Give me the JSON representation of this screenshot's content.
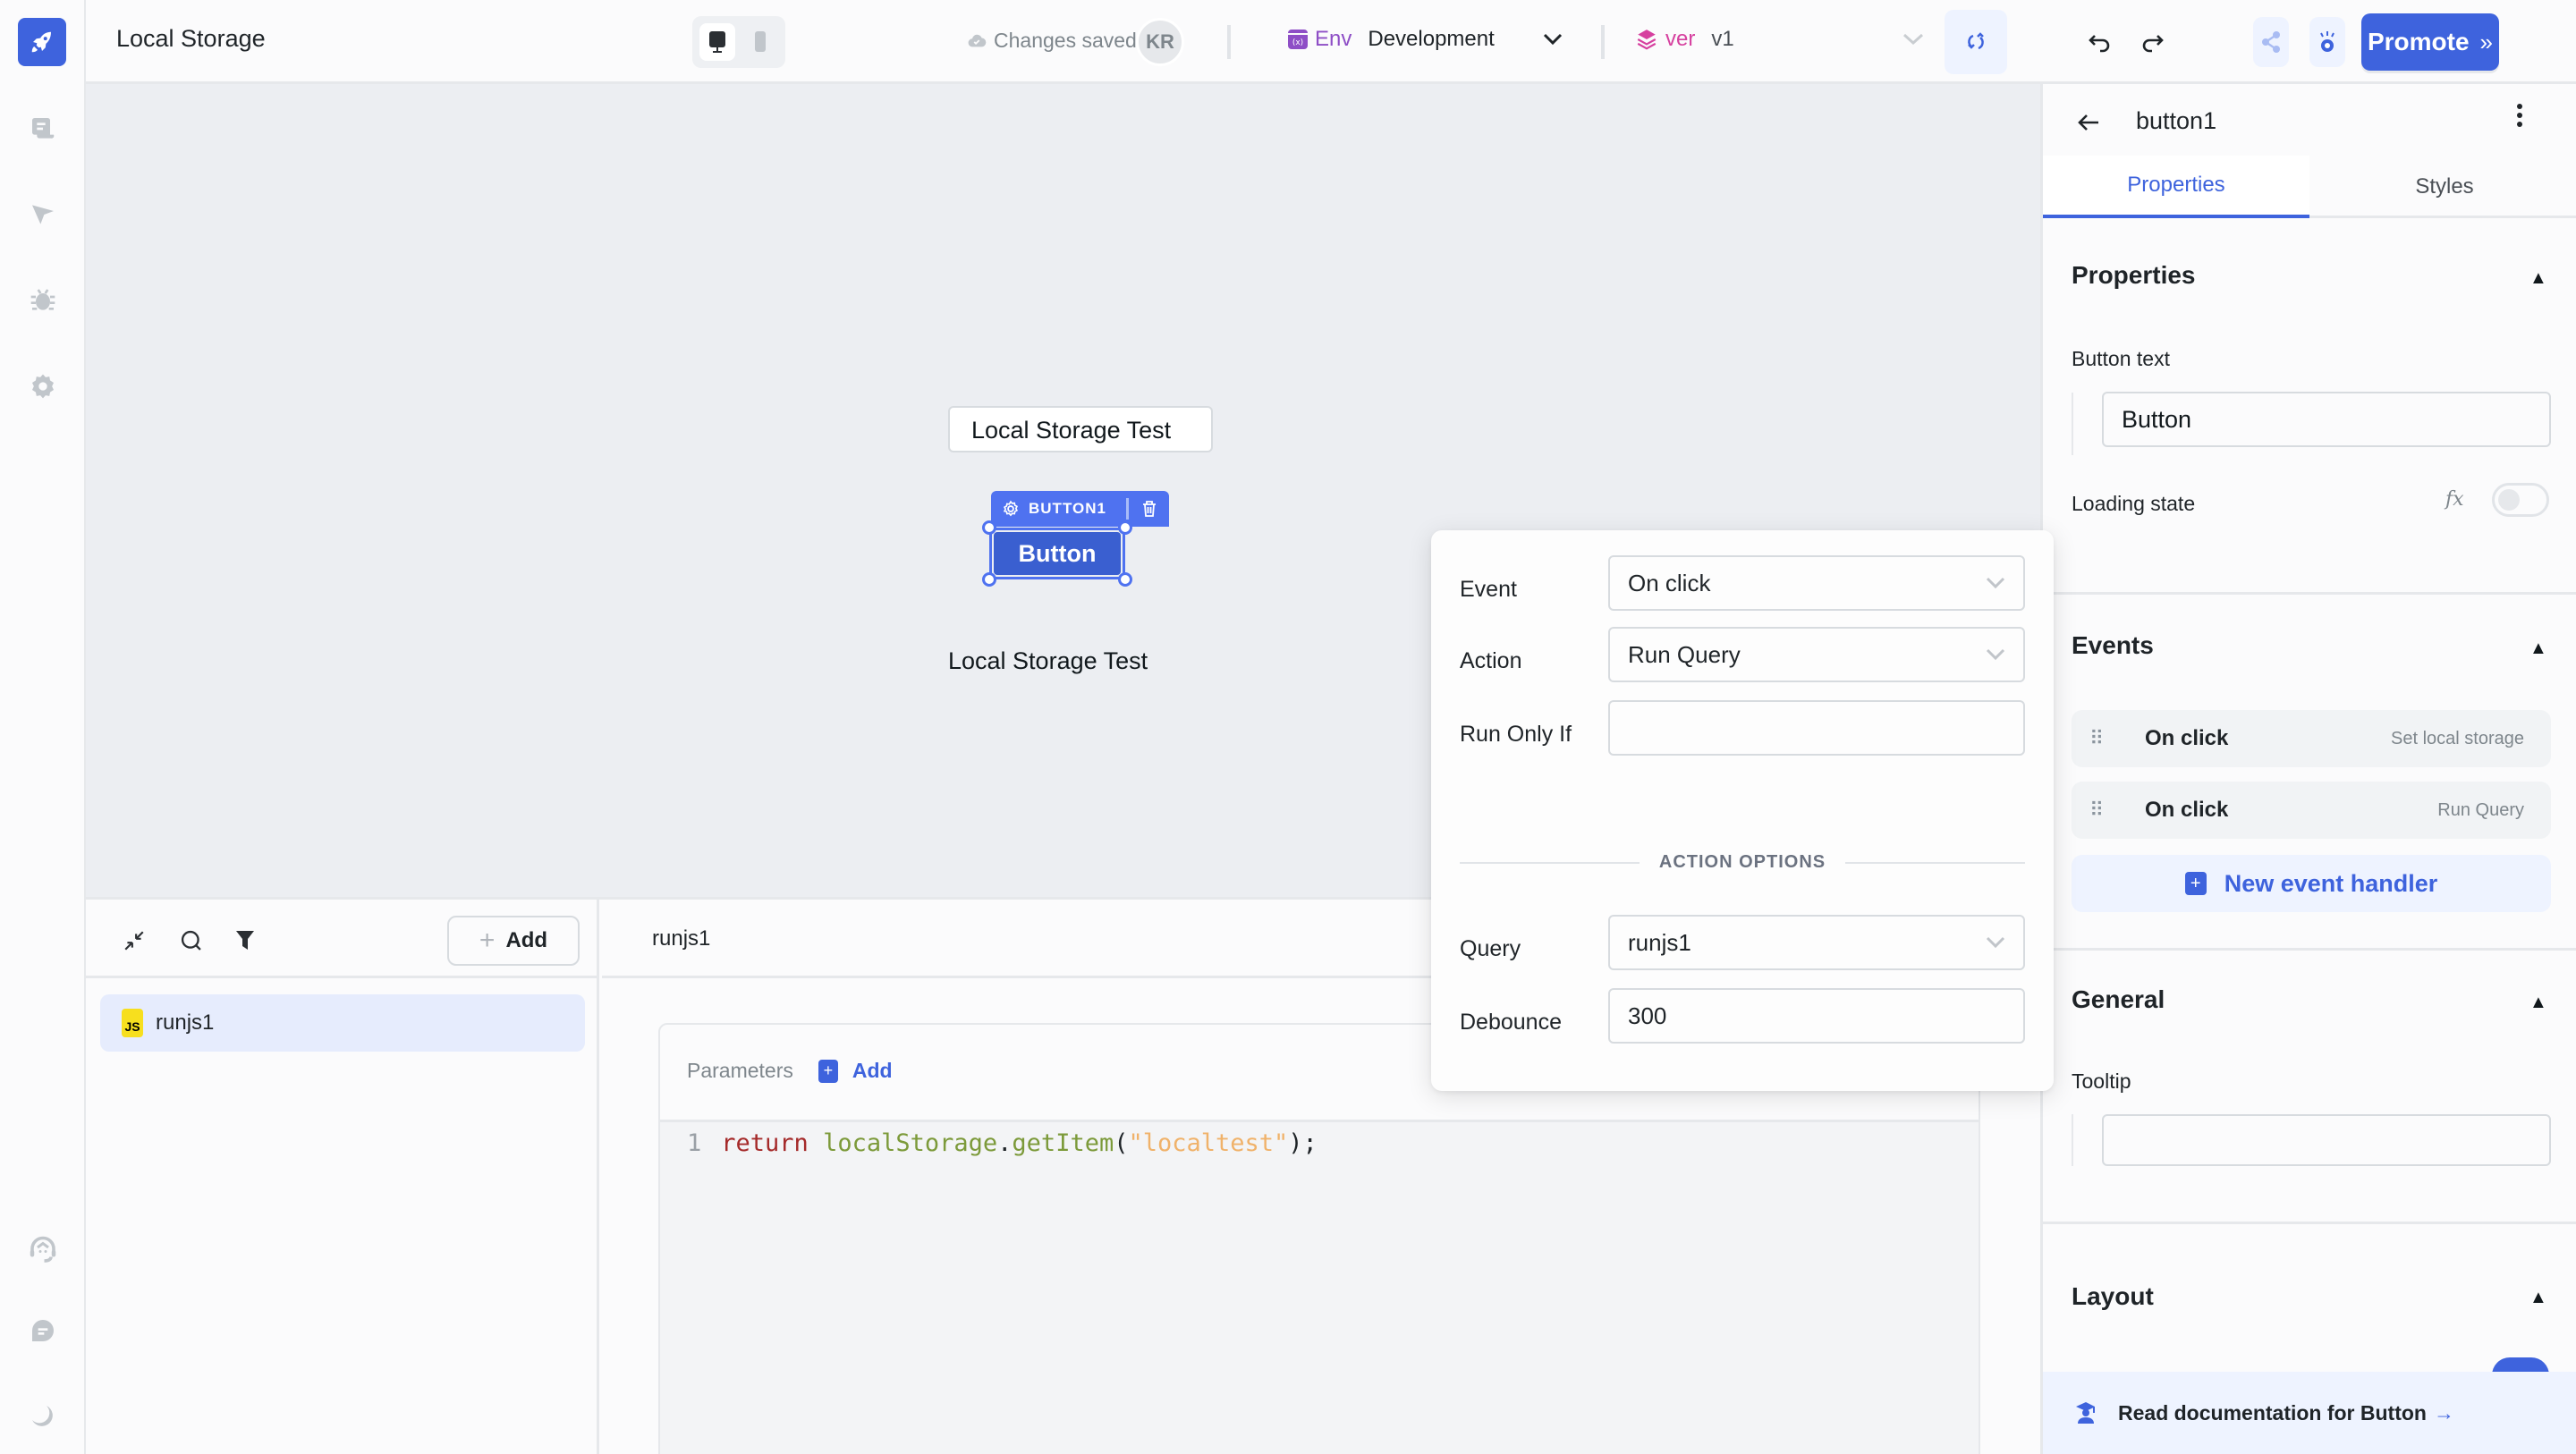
{
  "app": {
    "title": "Local Storage",
    "save_status": "Changes saved",
    "user_initials": "KR",
    "env_label": "Env",
    "env_value": "Development",
    "version_label": "ver",
    "version_value": "v1",
    "promote_label": "Promote",
    "brand_color": "#3e63dd"
  },
  "rail": {
    "top_icons": [
      "pages-icon",
      "inspector-icon",
      "debugger-icon",
      "settings-icon"
    ],
    "bottom_icons": [
      "support-icon",
      "comments-icon",
      "dark-mode-icon"
    ]
  },
  "canvas": {
    "text_input_value": "Local Storage Test",
    "selected_widget_name": "BUTTON1",
    "button_widget_label": "Button",
    "text_widget_value": "Local Storage Test"
  },
  "query_panel": {
    "add_label": "Add",
    "queries": [
      {
        "type_badge": "JS",
        "name": "runjs1"
      }
    ],
    "active_query_name": "runjs1",
    "parameters_label": "Parameters",
    "parameters_add_label": "Add",
    "code": {
      "line_number": "1",
      "keyword": "return",
      "object": "localStorage",
      "dot": ".",
      "method": "getItem",
      "open": "(",
      "string": "\"localtest\"",
      "close": ");"
    }
  },
  "event_popover": {
    "event_label": "Event",
    "event_value": "On click",
    "action_label": "Action",
    "action_value": "Run Query",
    "run_only_if_label": "Run Only If",
    "run_only_if_value": "",
    "section_title": "ACTION OPTIONS",
    "query_label": "Query",
    "query_value": "runjs1",
    "debounce_label": "Debounce",
    "debounce_value": "300"
  },
  "inspector": {
    "component_name": "button1",
    "tabs": [
      {
        "label": "Properties",
        "active": true
      },
      {
        "label": "Styles",
        "active": false
      }
    ],
    "properties": {
      "title": "Properties",
      "button_text_label": "Button text",
      "button_text_value": "Button",
      "loading_state_label": "Loading state",
      "loading_state_fx": "fx",
      "loading_state_on": false
    },
    "events": {
      "title": "Events",
      "handlers": [
        {
          "event": "On click",
          "action": "Set local storage"
        },
        {
          "event": "On click",
          "action": "Run Query"
        }
      ],
      "new_handler_label": "New event handler"
    },
    "general": {
      "title": "General",
      "tooltip_label": "Tooltip",
      "tooltip_value": ""
    },
    "layout": {
      "title": "Layout"
    },
    "doc_link": "Read documentation for Button",
    "doc_arrow": "→"
  }
}
